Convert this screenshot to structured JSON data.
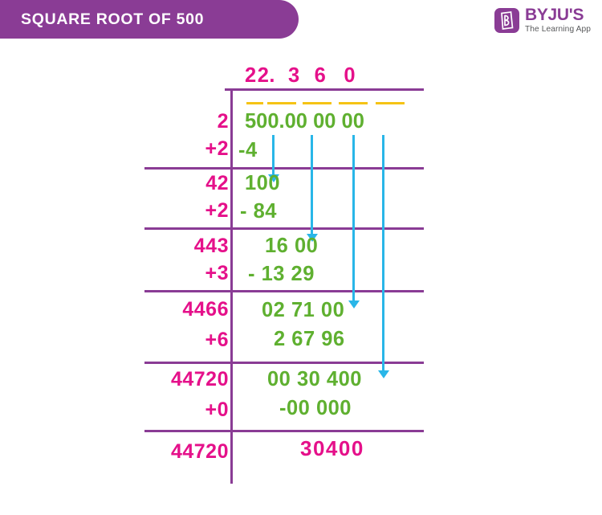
{
  "header": {
    "title": "SQUARE ROOT OF 500",
    "banner_color": "#8a3c95"
  },
  "logo": {
    "mark_letter": "B",
    "wordmark": "BYJU'S",
    "tagline": "The Learning App",
    "color": "#8a3c95"
  },
  "colors": {
    "divisor": "#e5108a",
    "dividend": "#5fb030",
    "rule": "#8a3c95",
    "pair_bar": "#f5c314",
    "drop_arrow": "#29b6e8",
    "remainder": "#e5108a"
  },
  "division": {
    "quotient_digits": [
      "2",
      "2.",
      "3",
      "6",
      "0"
    ],
    "quotient_display": "22. 3 6 0",
    "dividend": "500.00 00 00",
    "remainder": "30400",
    "rows": [
      {
        "divisor": "2",
        "add": "+2",
        "value": "500.00 00 00",
        "subtrahend": "-4"
      },
      {
        "divisor": "42",
        "add": "+2",
        "value": "100",
        "subtrahend": "- 84"
      },
      {
        "divisor": "443",
        "add": "+3",
        "value": "16 00",
        "subtrahend": "- 13 29"
      },
      {
        "divisor": "4466",
        "add": "+6",
        "value": "02 71 00",
        "subtrahend": "2 67 96"
      },
      {
        "divisor": "44720",
        "add": "+0",
        "value": "00 30 400",
        "subtrahend": "-00 000"
      },
      {
        "divisor": "44720",
        "add": "",
        "value": "30400",
        "subtrahend": ""
      }
    ]
  }
}
